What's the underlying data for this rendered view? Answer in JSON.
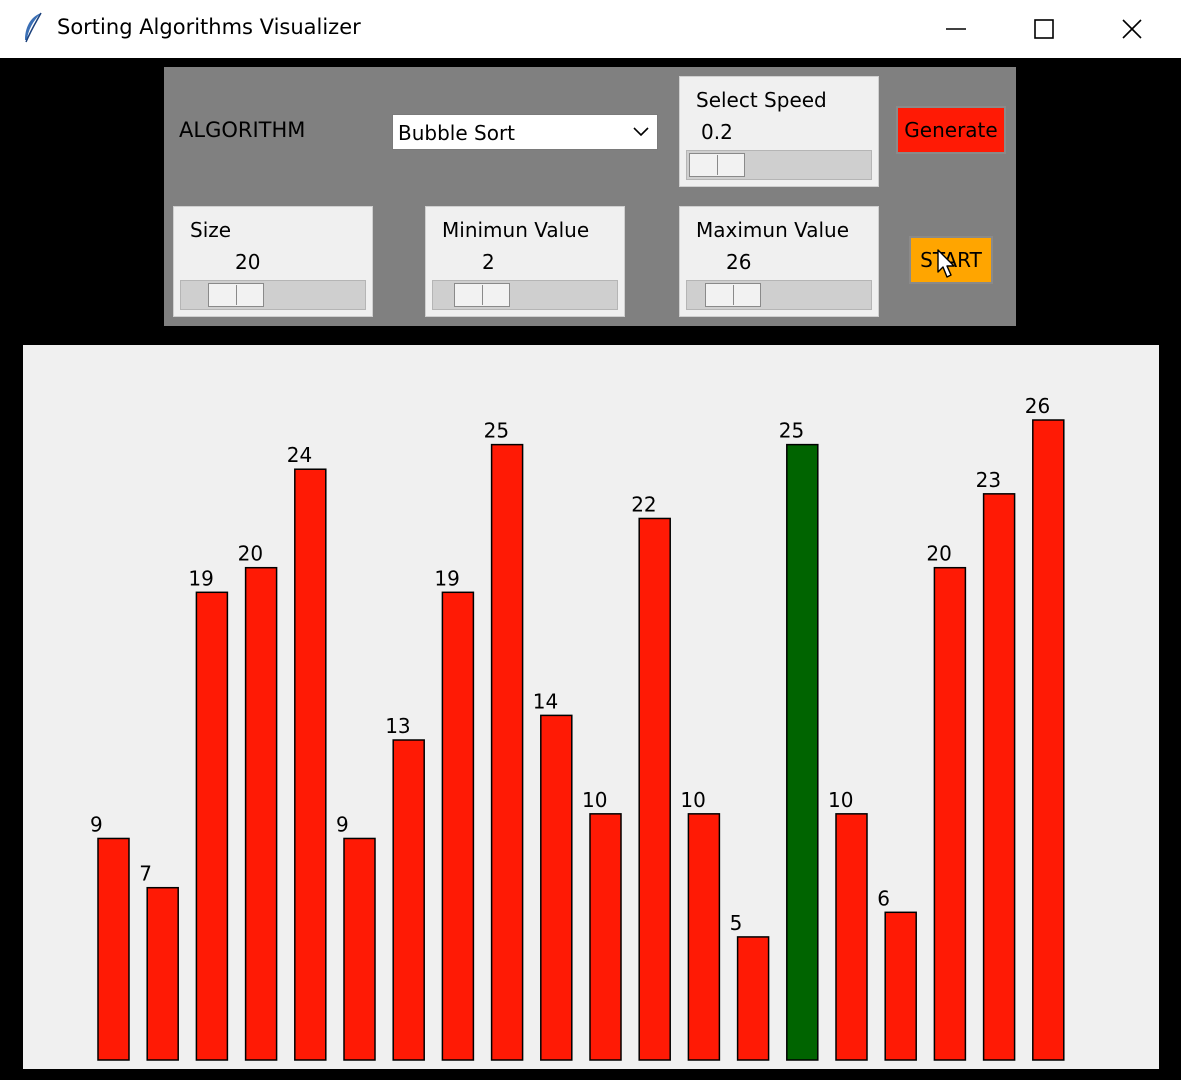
{
  "window": {
    "title": "Sorting Algorithms Visualizer",
    "icon": "feather-icon"
  },
  "controls": {
    "algorithm_label": "ALGORITHM",
    "algorithm_selected": "Bubble Sort",
    "speed": {
      "label": "Select Speed",
      "value": "0.2",
      "fraction": 0.0
    },
    "generate_label": "Generate",
    "size": {
      "label": "Size",
      "value": "20",
      "fraction": 0.2
    },
    "min_value": {
      "label": "Minimun Value",
      "value": "2",
      "fraction": 0.15
    },
    "max_value": {
      "label": "Maximun Value",
      "value": "26",
      "fraction": 0.13
    },
    "start_label": "START"
  },
  "colors": {
    "bar_default": "#ff1a05",
    "bar_active": "#006400",
    "generate_bg": "#ff1a05",
    "start_bg": "#ffa500",
    "panel_bg": "#808080",
    "canvas_bg": "#f0f0f0"
  },
  "chart_data": {
    "type": "bar",
    "title": "",
    "xlabel": "",
    "ylabel": "",
    "values": [
      9,
      7,
      19,
      20,
      24,
      9,
      13,
      19,
      25,
      14,
      10,
      22,
      10,
      5,
      25,
      10,
      6,
      20,
      23,
      26
    ],
    "highlighted_index": 14
  }
}
